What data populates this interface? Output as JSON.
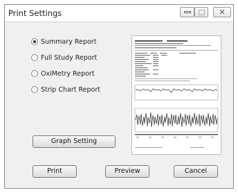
{
  "window": {
    "title": "Print Settings",
    "close_glyph": "✕"
  },
  "report_options": [
    {
      "label": "Summary Report",
      "selected": true
    },
    {
      "label": "Full Study Report",
      "selected": false
    },
    {
      "label": "OxiMetry Report",
      "selected": false
    },
    {
      "label": "Strip Chart Report",
      "selected": false
    }
  ],
  "buttons": {
    "graph_setting": "Graph Setting",
    "print": "Print",
    "preview": "Preview",
    "cancel": "Cancel"
  },
  "icons": [
    "minimize-icon",
    "maximize-icon",
    "close-icon",
    "radio-icon"
  ]
}
